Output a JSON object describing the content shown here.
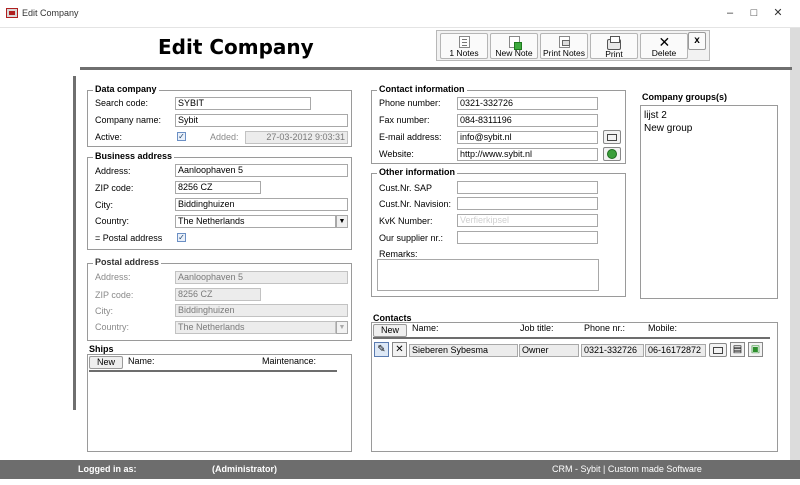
{
  "window": {
    "title": "Edit Company",
    "minimize": "–",
    "maximize": "□",
    "close": "✕"
  },
  "page_title": "Edit Company",
  "toolbar": {
    "notes": "1 Notes",
    "new_note": "New Note",
    "print_notes": "Print Notes",
    "print": "Print",
    "delete": "Delete",
    "close": "x"
  },
  "data_company": {
    "label": "Data company",
    "search_code_label": "Search code:",
    "search_code": "SYBIT",
    "company_name_label": "Company name:",
    "company_name": "Sybit",
    "active_label": "Active:",
    "active_checked": true,
    "added_label": "Added:",
    "added": "27-03-2012 9:03:31"
  },
  "business_address": {
    "label": "Business address",
    "address_label": "Address:",
    "address": "Aanloophaven 5",
    "zip_label": "ZIP code:",
    "zip": "8256 CZ",
    "city_label": "City:",
    "city": "Biddinghuizen",
    "country_label": "Country:",
    "country": "The Netherlands",
    "postal_label": "= Postal address",
    "postal_checked": true
  },
  "postal_address": {
    "label": "Postal address",
    "address_label": "Address:",
    "address": "Aanloophaven 5",
    "zip_label": "ZIP code:",
    "zip": "8256 CZ",
    "city_label": "City:",
    "city": "Biddinghuizen",
    "country_label": "Country:",
    "country": "The Netherlands"
  },
  "ships": {
    "label": "Ships",
    "new": "New",
    "col_name": "Name:",
    "col_maintenance": "Maintenance:"
  },
  "contact_info": {
    "label": "Contact information",
    "phone_label": "Phone number:",
    "phone": "0321-332726",
    "fax_label": "Fax number:",
    "fax": "084-8311196",
    "email_label": "E-mail address:",
    "email": "info@sybit.nl",
    "website_label": "Website:",
    "website": "http://www.sybit.nl"
  },
  "other_info": {
    "label": "Other information",
    "custnr_sap_label": "Cust.Nr. SAP",
    "custnr_navision_label": "Cust.Nr. Navision:",
    "kvk_label": "KvK Number:",
    "kvk_placeholder": "Verfierkipsel",
    "supplier_label": "Our supplier nr.:",
    "remarks_label": "Remarks:"
  },
  "company_groups": {
    "label": "Company groups(s)",
    "items": [
      "lijst 2",
      "New group"
    ]
  },
  "contacts": {
    "label": "Contacts",
    "new": "New",
    "col_name": "Name:",
    "col_job": "Job title:",
    "col_phone": "Phone nr.:",
    "col_mobile": "Mobile:",
    "rows": [
      {
        "name": "Sieberen Sybesma",
        "job": "Owner",
        "phone": "0321-332726",
        "mobile": "06-16172872"
      }
    ]
  },
  "status": {
    "logged_in_label": "Logged in as:",
    "user": "(Administrator)",
    "app": "CRM - Sybit | Custom made Software"
  },
  "colors": {
    "statusbar": "#6d6d6d",
    "accent_check": "#6b8fc4"
  },
  "icons": [
    "app-icon",
    "notes-icon",
    "new-note-icon",
    "print-notes-icon",
    "print-icon",
    "delete-icon",
    "mail-icon",
    "globe-icon",
    "edit-icon",
    "remove-icon",
    "send-mail-icon",
    "note-icon",
    "add-note-icon",
    "checkmark-icon",
    "dropdown-arrow-icon"
  ]
}
